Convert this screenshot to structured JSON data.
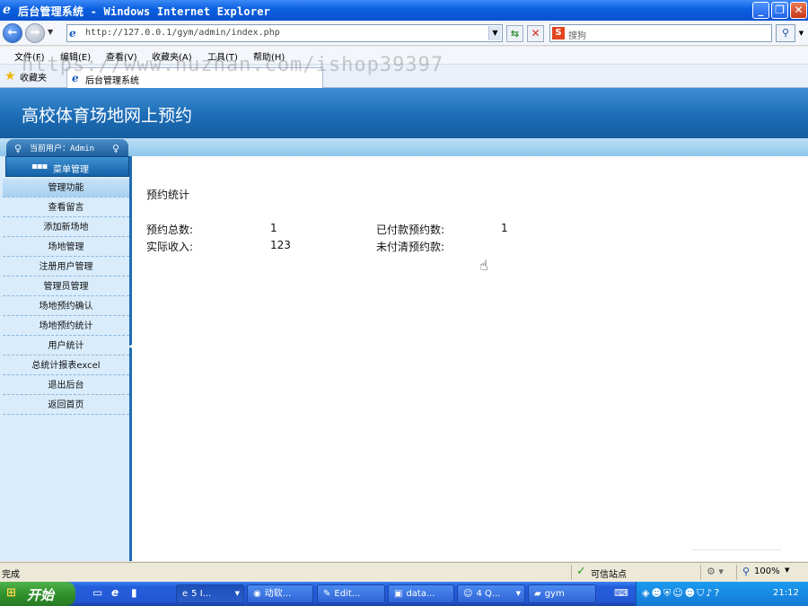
{
  "window": {
    "title": "后台管理系统 - Windows Internet Explorer",
    "minimize": "_",
    "maximize": "❐",
    "close": "✕"
  },
  "nav": {
    "url": "http://127.0.0.1/gym/admin/index.php",
    "search_placeholder": "搜狗",
    "search_logo": "S"
  },
  "menu": [
    "文件(F)",
    "编辑(E)",
    "查看(V)",
    "收藏夹(A)",
    "工具(T)",
    "帮助(H)"
  ],
  "watermark": "https://www.huzhan.com/ishop39397",
  "favorites": {
    "label": "收藏夹",
    "tab_label": "后台管理系统"
  },
  "site": {
    "title": "高校体育场地网上预约",
    "current_user": "当前用户：Admin",
    "menu_header": "菜单管理"
  },
  "sidebar": {
    "section": "管理功能",
    "items": [
      "查看留言",
      "添加新场地",
      "场地管理",
      "注册用户管理",
      "管理员管理",
      "场地预约确认",
      "场地预约统计",
      "用户统计",
      "总统计报表excel",
      "退出后台",
      "返回首页"
    ]
  },
  "stats": {
    "heading": "预约统计",
    "total_label": "预约总数:",
    "total_value": "1",
    "paid_label": "已付款预约数:",
    "paid_value": "1",
    "income_label": "实际收入:",
    "income_value": "123",
    "unpaid_label": "未付清预约款:",
    "unpaid_value": ""
  },
  "status": {
    "text": "完成",
    "zone": "可信站点",
    "zoom": "100%"
  },
  "taskbar": {
    "start": "开始",
    "tasks": [
      "5 I...",
      "动软...",
      "Edit...",
      "data...",
      "4 Q...",
      "gym"
    ],
    "clock": "21:12"
  }
}
